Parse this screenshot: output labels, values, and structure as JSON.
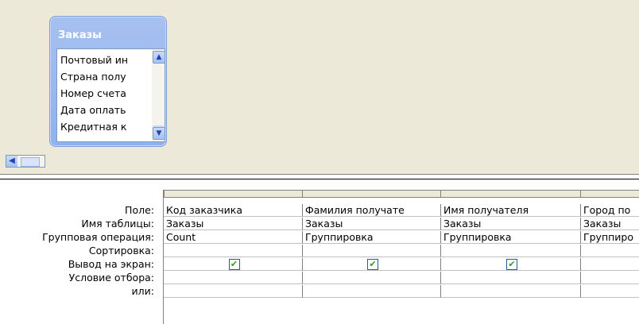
{
  "table": {
    "title": "Заказы",
    "fields": [
      "Почтовый ин",
      "Страна полу",
      "Номер счета",
      "Дата оплать",
      "Кредитная к"
    ]
  },
  "scroll_icons": {
    "up": "▲",
    "down": "▼",
    "left": "◀"
  },
  "grid": {
    "row_labels": [
      "Поле:",
      "Имя таблицы:",
      "Групповая операция:",
      "Сортировка:",
      "Вывод на экран:",
      "Условие отбора:",
      "или:"
    ],
    "columns": [
      {
        "field": "Код заказчика",
        "table": "Заказы",
        "group": "Count",
        "sort": "",
        "show": "✔",
        "criteria": "",
        "or": ""
      },
      {
        "field": "Фамилия получате",
        "table": "Заказы",
        "group": "Группировка",
        "sort": "",
        "show": "✔",
        "criteria": "",
        "or": ""
      },
      {
        "field": "Имя получателя",
        "table": "Заказы",
        "group": "Группировка",
        "sort": "",
        "show": "✔",
        "criteria": "",
        "or": ""
      },
      {
        "field": "Город по",
        "table": "Заказы",
        "group": "Группиро",
        "sort": "",
        "show": "",
        "criteria": "",
        "or": ""
      }
    ]
  }
}
